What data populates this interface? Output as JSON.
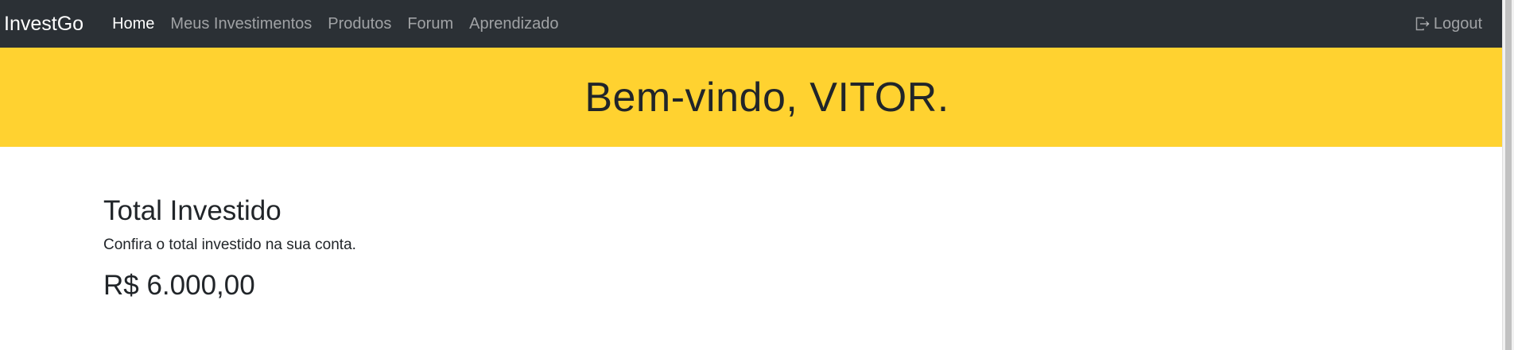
{
  "navbar": {
    "brand": "InvestGo",
    "links": [
      {
        "label": "Home",
        "active": true
      },
      {
        "label": "Meus Investimentos",
        "active": false
      },
      {
        "label": "Produtos",
        "active": false
      },
      {
        "label": "Forum",
        "active": false
      },
      {
        "label": "Aprendizado",
        "active": false
      }
    ],
    "logout_label": "Logout",
    "logout_icon": "logout-icon"
  },
  "hero": {
    "greeting": "Bem-vindo, VITOR."
  },
  "summary": {
    "title": "Total Investido",
    "description": "Confira o total investido na sua conta.",
    "amount": "R$ 6.000,00"
  },
  "colors": {
    "navbar_bg": "#2b3035",
    "hero_bg": "#ffd230",
    "text": "#212529"
  }
}
